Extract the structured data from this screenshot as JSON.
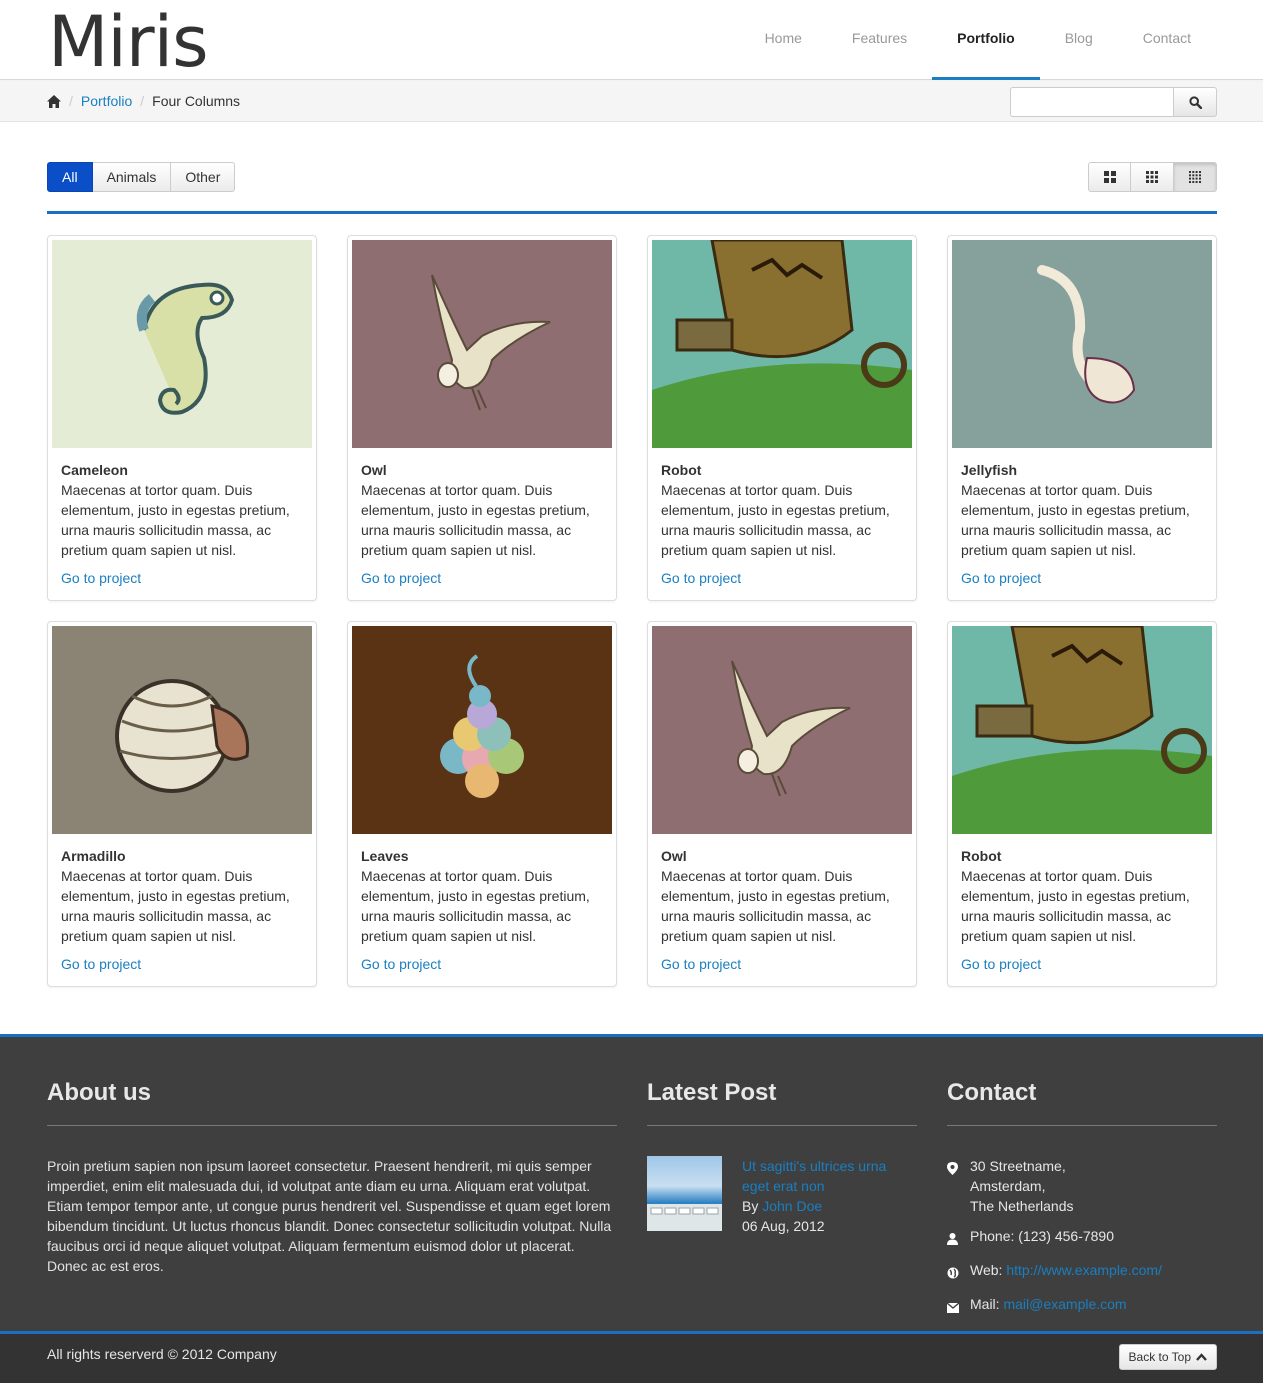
{
  "brand": {
    "logo_text": "Miris"
  },
  "nav": {
    "items": [
      {
        "label": "Home",
        "active": false
      },
      {
        "label": "Features",
        "active": false
      },
      {
        "label": "Portfolio",
        "active": true
      },
      {
        "label": "Blog",
        "active": false
      },
      {
        "label": "Contact",
        "active": false
      }
    ]
  },
  "breadcrumb": {
    "home_icon": "home-icon",
    "link": "Portfolio",
    "current": "Four Columns",
    "separator": "/"
  },
  "search": {
    "placeholder": "",
    "button_icon": "search-icon"
  },
  "filters": {
    "items": [
      {
        "label": "All",
        "active": true
      },
      {
        "label": "Animals",
        "active": false
      },
      {
        "label": "Other",
        "active": false
      }
    ]
  },
  "view_toggle": {
    "items": [
      {
        "icon": "grid-large-icon",
        "active": false
      },
      {
        "icon": "grid-medium-icon",
        "active": false
      },
      {
        "icon": "grid-small-icon",
        "active": true
      }
    ]
  },
  "portfolio": {
    "items": [
      {
        "title": "Cameleon",
        "description": "Maecenas at tortor quam. Duis elementum, justo in egestas pretium, urna mauris sollicitudin massa, ac pretium quam sapien ut nisl.",
        "link": "Go to project",
        "bg": "#e5ecd6"
      },
      {
        "title": "Owl",
        "description": "Maecenas at tortor quam. Duis elementum, justo in egestas pretium, urna mauris sollicitudin massa, ac pretium quam sapien ut nisl.",
        "link": "Go to project",
        "bg": "#8e6e70"
      },
      {
        "title": "Robot",
        "description": "Maecenas at tortor quam. Duis elementum, justo in egestas pretium, urna mauris sollicitudin massa, ac pretium quam sapien ut nisl.",
        "link": "Go to project",
        "bg": "#6fb8a8"
      },
      {
        "title": "Jellyfish",
        "description": "Maecenas at tortor quam. Duis elementum, justo in egestas pretium, urna mauris sollicitudin massa, ac pretium quam sapien ut nisl.",
        "link": "Go to project",
        "bg": "#86a09c"
      },
      {
        "title": "Armadillo",
        "description": "Maecenas at tortor quam. Duis elementum, justo in egestas pretium, urna mauris sollicitudin massa, ac pretium quam sapien ut nisl.",
        "link": "Go to project",
        "bg": "#8b8374"
      },
      {
        "title": "Leaves",
        "description": "Maecenas at tortor quam. Duis elementum, justo in egestas pretium, urna mauris sollicitudin massa, ac pretium quam sapien ut nisl.",
        "link": "Go to project",
        "bg": "#5a3314"
      },
      {
        "title": "Owl",
        "description": "Maecenas at tortor quam. Duis elementum, justo in egestas pretium, urna mauris sollicitudin massa, ac pretium quam sapien ut nisl.",
        "link": "Go to project",
        "bg": "#8e6e70"
      },
      {
        "title": "Robot",
        "description": "Maecenas at tortor quam. Duis elementum, justo in egestas pretium, urna mauris sollicitudin massa, ac pretium quam sapien ut nisl.",
        "link": "Go to project",
        "bg": "#6fb8a8"
      }
    ]
  },
  "footer": {
    "about": {
      "title": "About us",
      "text": "Proin pretium sapien non ipsum laoreet consectetur. Praesent hendrerit, mi quis semper imperdiet, enim elit malesuada dui, id volutpat ante diam eu urna. Aliquam erat volutpat. Etiam tempor tempor ante, ut congue purus hendrerit vel. Suspendisse et quam eget lorem bibendum tincidunt. Ut luctus rhoncus blandit. Donec consectetur sollicitudin volutpat. Nulla faucibus orci id neque aliquet volutpat. Aliquam fermentum euismod dolor ut placerat. Donec ac est eros."
    },
    "latest_post": {
      "title": "Latest Post",
      "post_title": "Ut sagitti's ultrices urna eget erat non",
      "by_label": "By",
      "author": "John Doe",
      "date": "06 Aug, 2012"
    },
    "contact": {
      "title": "Contact",
      "address_lines": [
        "30 Streetname,",
        "Amsterdam,",
        "The Netherlands"
      ],
      "phone_label": "Phone:",
      "phone": "(123) 456-7890",
      "web_label": "Web:",
      "web": "http://www.example.com/",
      "mail_label": "Mail:",
      "mail": "mail@example.com"
    },
    "copyright": "All rights reserverd © 2012 Company",
    "back_to_top": "Back to Top"
  },
  "colors": {
    "accent": "#1a6fc0",
    "link": "#1a7fc1",
    "filter_active": "#0b4fc8",
    "footer_bg": "#3f3f3f",
    "bottombar_bg": "#333333"
  }
}
